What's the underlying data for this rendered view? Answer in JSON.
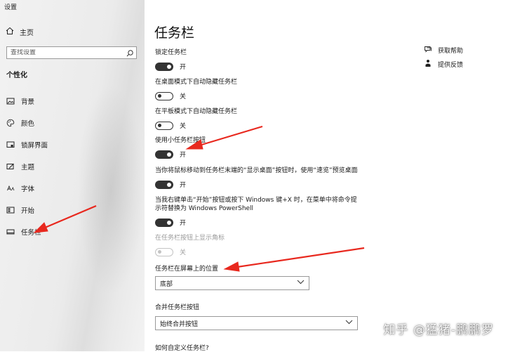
{
  "window": {
    "title": "设置"
  },
  "sidebar": {
    "home_label": "主页",
    "search_placeholder": "查找设置",
    "section_title": "个性化",
    "items": [
      {
        "label": "背景",
        "icon": "picture-icon"
      },
      {
        "label": "颜色",
        "icon": "palette-icon"
      },
      {
        "label": "锁屏界面",
        "icon": "lock-screen-icon"
      },
      {
        "label": "主题",
        "icon": "theme-icon"
      },
      {
        "label": "字体",
        "icon": "font-icon"
      },
      {
        "label": "开始",
        "icon": "start-icon"
      },
      {
        "label": "任务栏",
        "icon": "taskbar-icon",
        "selected": true
      }
    ]
  },
  "main": {
    "title": "任务栏",
    "settings": [
      {
        "label": "锁定任务栏",
        "state": "开",
        "on": true
      },
      {
        "label": "在桌面模式下自动隐藏任务栏",
        "state": "关",
        "on": false
      },
      {
        "label": "在平板模式下自动隐藏任务栏",
        "state": "关",
        "on": false
      },
      {
        "label": "使用小任务栏按钮",
        "state": "开",
        "on": true
      },
      {
        "label": "当你将鼠标移动到任务栏末端的“显示桌面”按钮时，使用“速览”预览桌面",
        "state": "开",
        "on": true
      },
      {
        "label_line1": "当我右键单击“开始”按钮或按下 Windows 键+X 时，在菜单中将命令提",
        "label_line2": "示符替换为 Windows PowerShell",
        "state": "开",
        "on": true
      },
      {
        "label": "在任务栏按钮上显示角标",
        "state": "关",
        "on": false,
        "disabled": true
      }
    ],
    "position": {
      "label": "任务栏在屏幕上的位置",
      "value": "底部"
    },
    "combine": {
      "label": "合并任务栏按钮",
      "value": "始终合并按钮"
    },
    "customize_link": "如何自定义任务栏?"
  },
  "help": {
    "get_help": "获取帮助",
    "feedback": "提供反馈"
  },
  "watermark": "知乎 @猛猪-鹏鹏罗",
  "colors": {
    "annotation_arrow": "#e8281e",
    "toggle_on": "#333333",
    "sidebar_bg": "#ededed"
  }
}
